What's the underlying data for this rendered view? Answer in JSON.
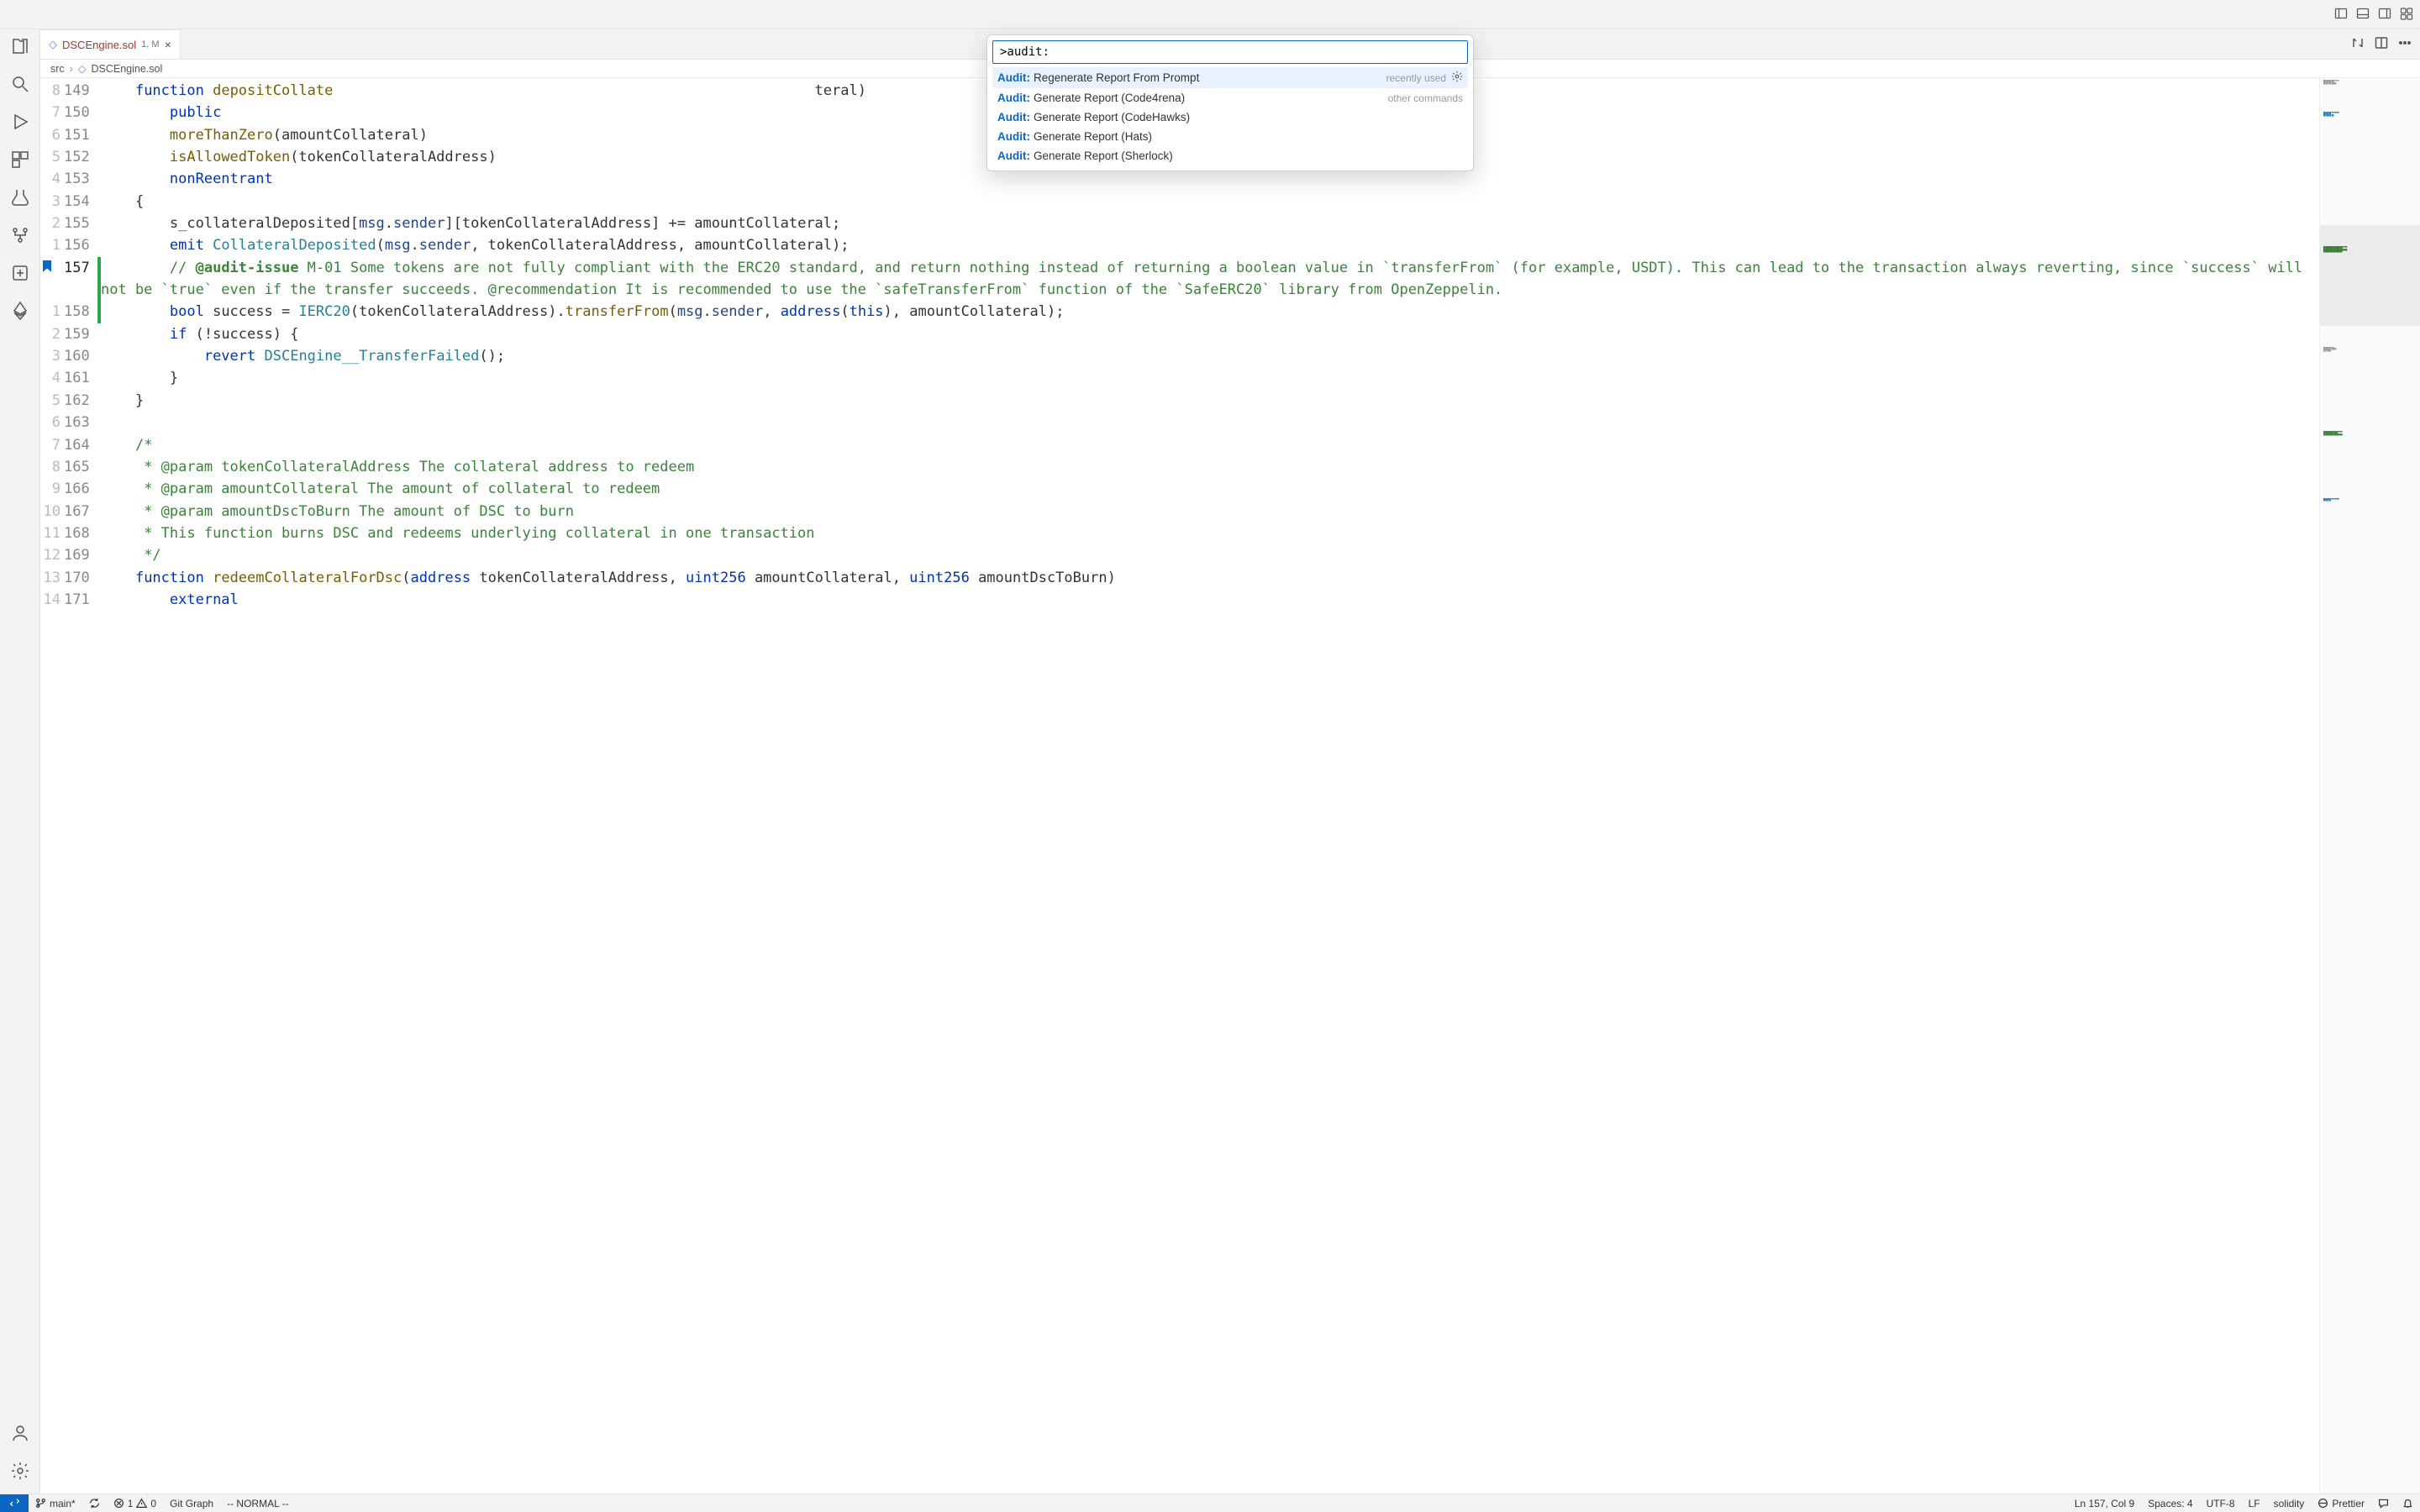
{
  "tab": {
    "name": "DSCEngine.sol",
    "meta": "1, M"
  },
  "breadcrumb": {
    "seg1": "src",
    "seg2": "DSCEngine.sol"
  },
  "palette": {
    "value": ">audit:",
    "items": [
      {
        "pre": "Audit:",
        "suf": " Regenerate Report From Prompt",
        "hint": "recently used",
        "gear": true
      },
      {
        "pre": "Audit:",
        "suf": " Generate Report (Code4rena)",
        "hint": "other commands"
      },
      {
        "pre": "Audit:",
        "suf": " Generate Report (CodeHawks)"
      },
      {
        "pre": "Audit:",
        "suf": " Generate Report (Hats)"
      },
      {
        "pre": "Audit:",
        "suf": " Generate Report (Sherlock)"
      }
    ]
  },
  "code": {
    "lines": [
      {
        "r": "8",
        "n": "149",
        "git": "",
        "html": "    <span class='kw'>function</span> <span class='fn'>depositCollate</span>                                                        <span>teral)</span>"
      },
      {
        "r": "7",
        "n": "150",
        "git": "",
        "html": "        <span class='kw'>public</span>"
      },
      {
        "r": "6",
        "n": "151",
        "git": "",
        "html": "        <span class='fn'>moreThanZero</span>(amountCollateral)"
      },
      {
        "r": "5",
        "n": "152",
        "git": "",
        "html": "        <span class='fn'>isAllowedToken</span>(tokenCollateralAddress)"
      },
      {
        "r": "4",
        "n": "153",
        "git": "",
        "html": "        <span class='kw'>nonReentrant</span>"
      },
      {
        "r": "3",
        "n": "154",
        "git": "",
        "html": "    {"
      },
      {
        "r": "2",
        "n": "155",
        "git": "",
        "html": "        s_collateralDeposited[<span class='va'>msg</span>.<span class='va'>sender</span>][tokenCollateralAddress] += amountCollateral;"
      },
      {
        "r": "1",
        "n": "156",
        "git": "",
        "html": "        <span class='kw'>emit</span> <span class='ty'>CollateralDeposited</span>(<span class='va'>msg</span>.<span class='va'>sender</span>, tokenCollateralAddress, amountCollateral);"
      },
      {
        "r": "",
        "n": "157",
        "git": "mod",
        "cur": true,
        "bm": true,
        "html": "        <span class='cm'>// </span><span class='tag'>@audit-issue</span><span class='cm'> M-01 Some tokens are not fully compliant with the ERC20 standard, and return nothing instead of returning a boolean value in `transferFrom` (for example, USDT). This can lead to the transaction always reverting, since `success` will not be `true` even if the transfer succeeds. @recommendation It is recommended to use the `safeTransferFrom` function of the `SafeERC20` library from OpenZeppelin.</span>"
      },
      {
        "r": "1",
        "n": "158",
        "git": "mod",
        "html": "        <span class='kw'>bool</span> success = <span class='ty'>IERC20</span>(tokenCollateralAddress).<span class='fn'>transferFrom</span>(<span class='va'>msg</span>.<span class='va'>sender</span>, <span class='kw'>address</span>(<span class='kw'>this</span>), amountCollateral);"
      },
      {
        "r": "2",
        "n": "159",
        "git": "",
        "html": "        <span class='kw'>if</span> (!success) {"
      },
      {
        "r": "3",
        "n": "160",
        "git": "",
        "html": "            <span class='kw'>revert</span> <span class='ty'>DSCEngine__TransferFailed</span>();"
      },
      {
        "r": "4",
        "n": "161",
        "git": "",
        "html": "        }"
      },
      {
        "r": "5",
        "n": "162",
        "git": "",
        "html": "    }"
      },
      {
        "r": "6",
        "n": "163",
        "git": "",
        "html": ""
      },
      {
        "r": "7",
        "n": "164",
        "git": "",
        "html": "    <span class='cm'>/*</span>"
      },
      {
        "r": "8",
        "n": "165",
        "git": "",
        "html": "     <span class='cm'>* @param tokenCollateralAddress The collateral address to redeem</span>"
      },
      {
        "r": "9",
        "n": "166",
        "git": "",
        "html": "     <span class='cm'>* @param amountCollateral The amount of collateral to redeem</span>"
      },
      {
        "r": "10",
        "n": "167",
        "git": "",
        "html": "     <span class='cm'>* @param amountDscToBurn The amount of DSC to burn</span>"
      },
      {
        "r": "11",
        "n": "168",
        "git": "",
        "html": "     <span class='cm'>* This function burns DSC and redeems underlying collateral in one transaction</span>"
      },
      {
        "r": "12",
        "n": "169",
        "git": "",
        "html": "     <span class='cm'>*/</span>"
      },
      {
        "r": "13",
        "n": "170",
        "git": "",
        "html": "    <span class='kw'>function</span> <span class='fn'>redeemCollateralForDsc</span>(<span class='kw'>address</span> tokenCollateralAddress, <span class='kw'>uint256</span> amountCollateral, <span class='kw'>uint256</span> amountDscToBurn)"
      },
      {
        "r": "14",
        "n": "171",
        "git": "",
        "html": "        <span class='kw'>external</span>"
      }
    ]
  },
  "status": {
    "branch": "main*",
    "sync": "",
    "err": "1",
    "warn": "0",
    "gitgraph": "Git Graph",
    "mode": "-- NORMAL --",
    "lncol": "Ln 157, Col 9",
    "spaces": "Spaces: 4",
    "enc": "UTF-8",
    "eol": "LF",
    "lang": "solidity",
    "prettier": "Prettier"
  }
}
